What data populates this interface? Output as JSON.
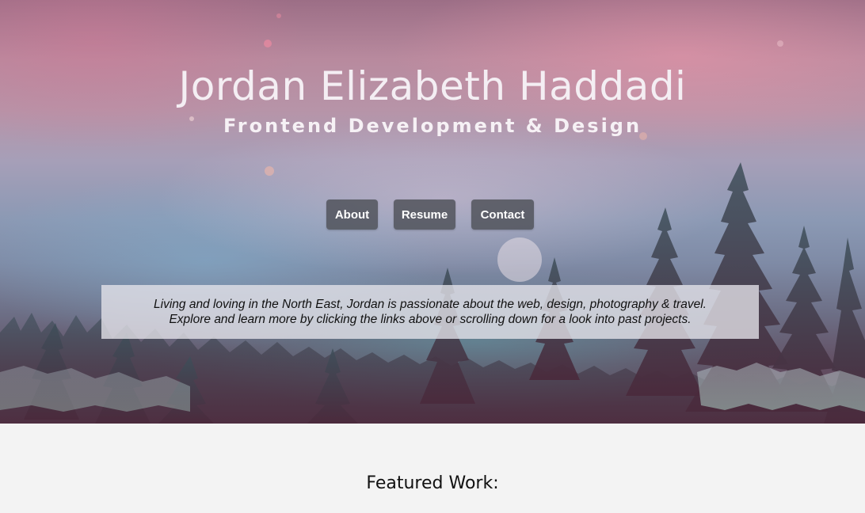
{
  "hero": {
    "name": "Jordan Elizabeth Haddadi",
    "tagline": "Frontend Development & Design",
    "intro_line_1": "Living and loving in the North East, Jordan is passionate about the web, design, photography & travel.",
    "intro_line_2": "Explore and learn more by clicking the links above or scrolling down for a look into past projects."
  },
  "nav": {
    "about_label": "About",
    "resume_label": "Resume",
    "contact_label": "Contact"
  },
  "featured": {
    "heading": "Featured Work:"
  },
  "colors": {
    "nav_button_bg": "#4e5058",
    "page_bg": "#f3f3f3",
    "title_text": "#f4eef3"
  }
}
